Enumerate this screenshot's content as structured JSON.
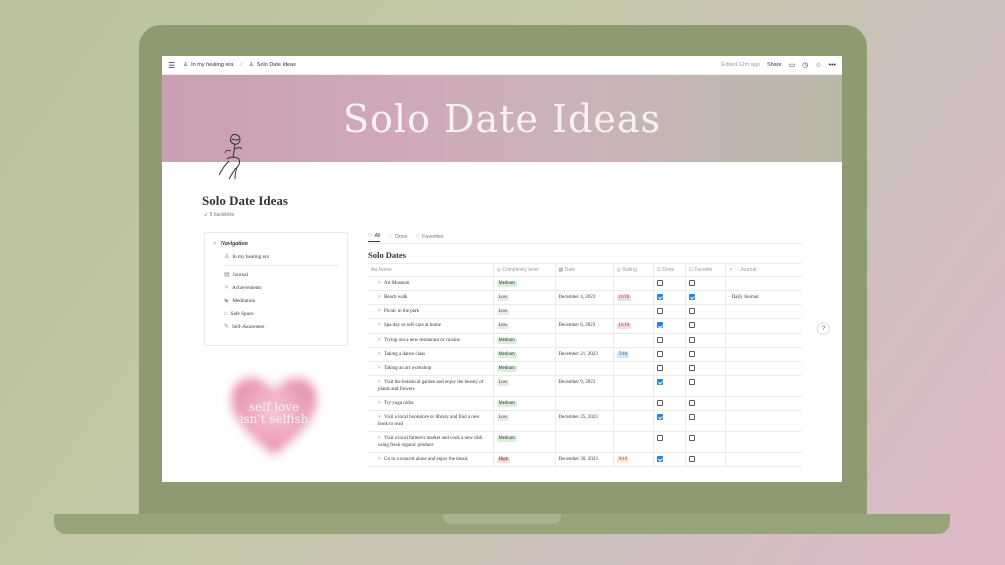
{
  "topbar": {
    "workspace": "In my healing era",
    "page": "Solo Date Ideas",
    "edited": "Edited 12m ago",
    "share": "Share"
  },
  "banner": {
    "title": "Solo Date Ideas"
  },
  "page": {
    "title": "Solo Date Ideas",
    "backlinks": "5 backlinks"
  },
  "navigation": {
    "header": "Navigation",
    "items": [
      {
        "label": "In my healing era"
      },
      {
        "label": "Journal"
      },
      {
        "label": "Achievements"
      },
      {
        "label": "Meditation"
      },
      {
        "label": "Safe Space"
      },
      {
        "label": "Self-Awareness"
      }
    ]
  },
  "heart_graphic": {
    "line1": "self love",
    "line2": "isn't selfish"
  },
  "database": {
    "views": [
      "All",
      "Done",
      "Favorites"
    ],
    "title": "Solo Dates",
    "columns": [
      "Name",
      "Complexity level",
      "Date",
      "Rating",
      "Done",
      "Favorite",
      "Journal"
    ],
    "rows": [
      {
        "name": "Art Museum",
        "complexity": "Medium",
        "date": "",
        "rating": "",
        "done": false,
        "favorite": false,
        "journal": ""
      },
      {
        "name": "Beach walk",
        "complexity": "Low",
        "date": "December 4, 2023",
        "rating": "11/10",
        "done": true,
        "favorite": true,
        "journal": "Daily Journal"
      },
      {
        "name": "Picnic in the park",
        "complexity": "Low",
        "date": "",
        "rating": "",
        "done": false,
        "favorite": false,
        "journal": ""
      },
      {
        "name": "Spa day or self-care at home",
        "complexity": "Low",
        "date": "December 6, 2023",
        "rating": "11/10",
        "done": true,
        "favorite": false,
        "journal": ""
      },
      {
        "name": "Trying out a new restaurant or cuisine",
        "complexity": "Medium",
        "date": "",
        "rating": "",
        "done": false,
        "favorite": false,
        "journal": ""
      },
      {
        "name": "Taking a dance class",
        "complexity": "Medium",
        "date": "December 21, 2023",
        "rating": "7/10",
        "done": false,
        "favorite": false,
        "journal": ""
      },
      {
        "name": "Taking an art workshop",
        "complexity": "Medium",
        "date": "",
        "rating": "",
        "done": false,
        "favorite": false,
        "journal": ""
      },
      {
        "name": "Visit the botanical garden and enjoy the beauty of plants and flowers",
        "complexity": "Low",
        "date": "December 9, 2023",
        "rating": "",
        "done": true,
        "favorite": false,
        "journal": ""
      },
      {
        "name": "Try yoga nidra",
        "complexity": "Medium",
        "date": "",
        "rating": "",
        "done": false,
        "favorite": false,
        "journal": ""
      },
      {
        "name": "Visit a local bookstore or library and find a new book to read",
        "complexity": "Low",
        "date": "December 25, 2023",
        "rating": "",
        "done": true,
        "favorite": false,
        "journal": ""
      },
      {
        "name": "Visit a local farmer's market and cook a new dish using fresh organic produce",
        "complexity": "Medium",
        "date": "",
        "rating": "",
        "done": false,
        "favorite": false,
        "journal": ""
      },
      {
        "name": "Go to a concert alone and enjoy the music",
        "complexity": "High",
        "date": "December 30, 2023",
        "rating": "9/10",
        "done": true,
        "favorite": false,
        "journal": ""
      }
    ]
  },
  "help": {
    "label": "?"
  },
  "colors": {
    "accent": "#2383e2",
    "laptop": "#8e9a6f",
    "banner_pink": "#c99fb1"
  }
}
